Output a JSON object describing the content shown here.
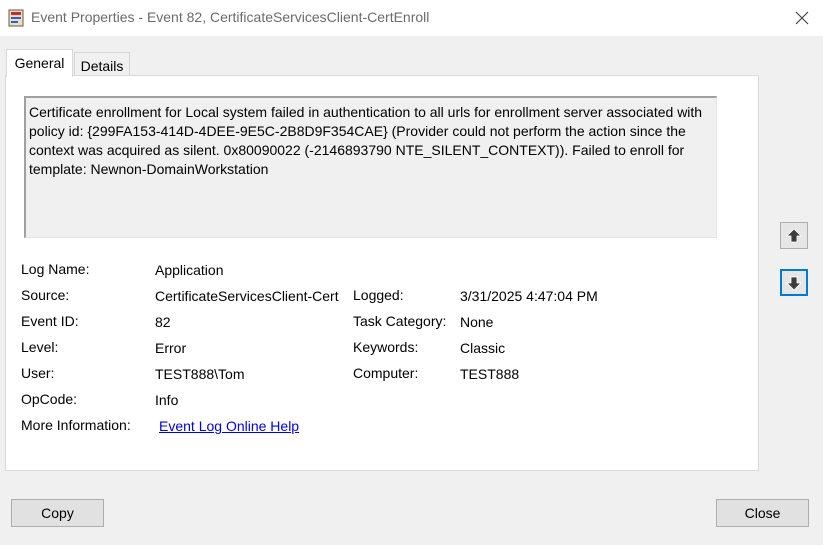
{
  "window": {
    "title": "Event Properties - Event 82, CertificateServicesClient-CertEnroll"
  },
  "tabs": [
    {
      "label": "General",
      "selected": true
    },
    {
      "label": "Details",
      "selected": false
    }
  ],
  "description": "Certificate enrollment for Local system failed in authentication to all urls for enrollment server associated with policy id: {299FA153-414D-4DEE-9E5C-2B8D9F354CAE} (Provider could not perform the action since the context was acquired as silent. 0x80090022 (-2146893790 NTE_SILENT_CONTEXT)). Failed to enroll for template: Newnon-DomainWorkstation",
  "fields": {
    "log_name": {
      "label": "Log Name:",
      "value": "Application"
    },
    "source": {
      "label": "Source:",
      "value": "CertificateServicesClient-Cert"
    },
    "event_id": {
      "label": "Event ID:",
      "value": "82"
    },
    "level": {
      "label": "Level:",
      "value": "Error"
    },
    "user": {
      "label": "User:",
      "value": "TEST888\\Tom"
    },
    "opcode": {
      "label": "OpCode:",
      "value": "Info"
    },
    "more_info": {
      "label": "More Information:",
      "value": "Event Log Online Help"
    },
    "logged": {
      "label": "Logged:",
      "value": "3/31/2025 4:47:04 PM"
    },
    "task_category": {
      "label": "Task Category:",
      "value": "None"
    },
    "keywords": {
      "label": "Keywords:",
      "value": "Classic"
    },
    "computer": {
      "label": "Computer:",
      "value": "TEST888"
    }
  },
  "buttons": {
    "copy": "Copy",
    "close": "Close"
  },
  "icons": {
    "app": "event-viewer-icon",
    "close": "close-icon",
    "up": "arrow-up-icon",
    "down": "arrow-down-icon"
  },
  "colors": {
    "link": "#0000e0",
    "focus": "#0078d7"
  }
}
